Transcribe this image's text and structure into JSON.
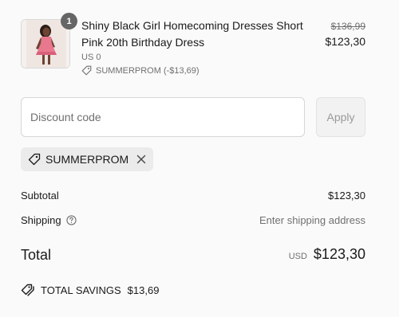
{
  "line_item": {
    "quantity": "1",
    "title": "Shiny Black Girl Homecoming Dresses Short Pink 20th Birthday Dress",
    "variant": "US 0",
    "discount_note": "SUMMERPROM (-$13,69)",
    "compare_price": "$136,99",
    "price": "$123,30",
    "image_icon": "product-thumbnail"
  },
  "discount_form": {
    "placeholder": "Discount code",
    "value": "",
    "apply_label": "Apply"
  },
  "applied_code": {
    "code": "SUMMERPROM",
    "icon": "tag-icon",
    "remove_icon": "close-icon"
  },
  "summary": {
    "subtotal_label": "Subtotal",
    "subtotal_value": "$123,30",
    "shipping_label": "Shipping",
    "shipping_value": "Enter shipping address",
    "total_label": "Total",
    "currency": "USD",
    "total_value": "$123,30"
  },
  "savings": {
    "label": "TOTAL SAVINGS",
    "amount": "$13,69",
    "icon": "tags-icon"
  },
  "colors": {
    "background": "#fafafa",
    "text": "#1a1a1a",
    "muted": "#707070",
    "badge": "#666666",
    "chip": "#ebebeb",
    "dress_pink": "#e8788e"
  }
}
